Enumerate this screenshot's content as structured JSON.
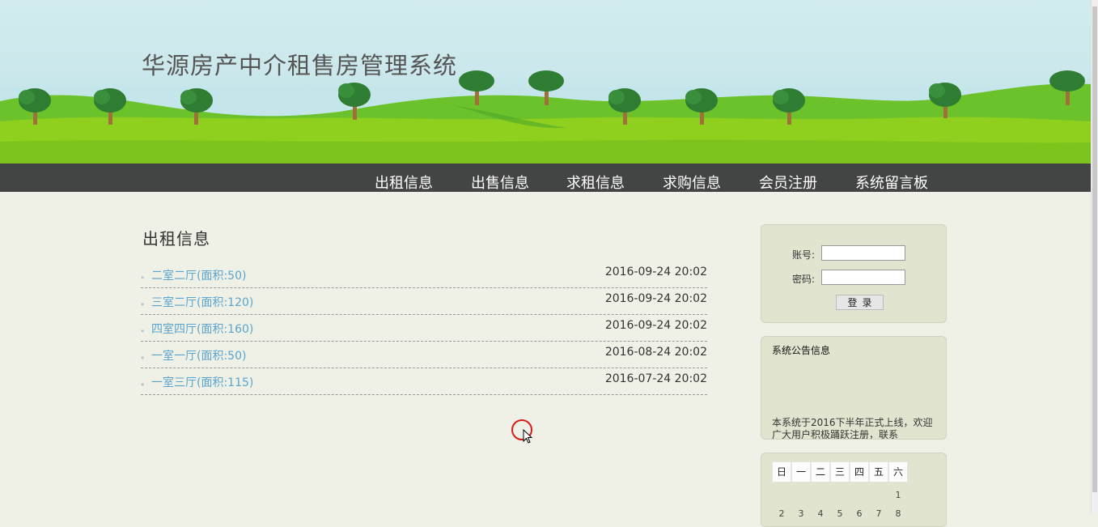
{
  "header": {
    "site_title": "华源房产中介租售房管理系统"
  },
  "nav": [
    {
      "label": "出租信息"
    },
    {
      "label": "出售信息"
    },
    {
      "label": "求租信息"
    },
    {
      "label": "求购信息"
    },
    {
      "label": "会员注册"
    },
    {
      "label": "系统留言板"
    }
  ],
  "main": {
    "section_title": "出租信息",
    "items": [
      {
        "title": "二室二厅(面积:50)",
        "date": "2016-09-24 20:02"
      },
      {
        "title": "三室二厅(面积:120)",
        "date": "2016-09-24 20:02"
      },
      {
        "title": "四室四厅(面积:160)",
        "date": "2016-09-24 20:02"
      },
      {
        "title": "一室一厅(面积:50)",
        "date": "2016-08-24 20:02"
      },
      {
        "title": "一室三厅(面积:115)",
        "date": "2016-07-24 20:02"
      }
    ]
  },
  "login": {
    "account_label": "账号:",
    "account_value": "",
    "password_label": "密码:",
    "password_value": "",
    "login_button": "登录"
  },
  "notice": {
    "title": "系统公告信息",
    "text": "本系统于2016下半年正式上线，欢迎广大用户积极踊跃注册，联系"
  },
  "calendar": {
    "weekdays": [
      "日",
      "一",
      "二",
      "三",
      "四",
      "五",
      "六"
    ],
    "days_row1": [
      "",
      "",
      "",
      "",
      "",
      "",
      "1"
    ],
    "days_row2": [
      "2",
      "3",
      "4",
      "5",
      "6",
      "7",
      "8"
    ]
  },
  "colors": {
    "nav_bg": "#434544",
    "link": "#5ba4cd",
    "page_bg": "#eff1e7",
    "panel_bg": "#e1e5cf",
    "cursor_ring": "#d91a1a"
  }
}
